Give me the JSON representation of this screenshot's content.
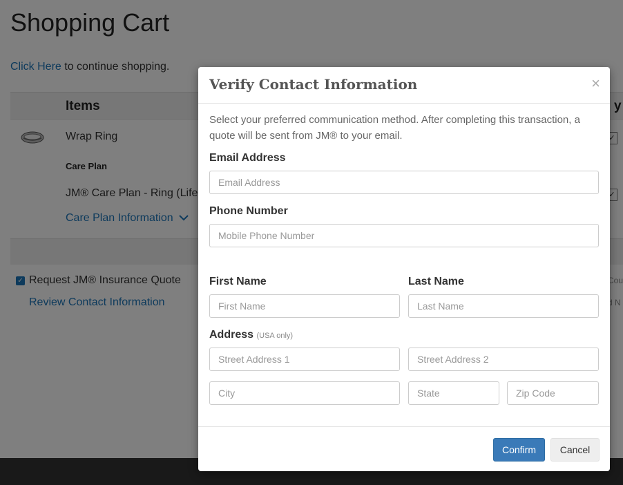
{
  "page": {
    "title": "Shopping Cart",
    "continue_link": "Click Here",
    "continue_text": " to continue shopping.",
    "items_header": "Items",
    "qty_header_partial": "y",
    "item_name": "Wrap Ring",
    "care_plan_heading": "Care Plan",
    "care_plan_name": "JM® Care Plan - Ring (Life",
    "care_plan_info": "Care Plan Information",
    "quote_checkbox_label": "Request JM® Insurance Quote",
    "review_link": "Review Contact Information",
    "ghost_right_1": "Cou",
    "ghost_right_2": "d N"
  },
  "modal": {
    "title": "Verify Contact Information",
    "close_symbol": "×",
    "intro": "Select your preferred communication method. After completing this transaction, a quote will be sent from JM® to your email.",
    "email_label": "Email Address",
    "email_placeholder": "Email Address",
    "phone_label": "Phone Number",
    "phone_placeholder": "Mobile Phone Number",
    "first_name_label": "First Name",
    "first_name_placeholder": "First Name",
    "last_name_label": "Last Name",
    "last_name_placeholder": "Last Name",
    "address_label": "Address",
    "address_note": "(USA only)",
    "street1_placeholder": "Street Address 1",
    "street2_placeholder": "Street Address 2",
    "city_placeholder": "City",
    "state_placeholder": "State",
    "zip_placeholder": "Zip Code",
    "confirm_label": "Confirm",
    "cancel_label": "Cancel"
  },
  "icons": {
    "chevron": "chevron-down-icon",
    "checkbox": "checkbox-checked-icon",
    "ring": "ring-thumbnail"
  },
  "colors": {
    "link": "#1a74b8",
    "primary_button": "#3a7ab8",
    "overlay": "rgba(0,0,0,0.5)"
  }
}
